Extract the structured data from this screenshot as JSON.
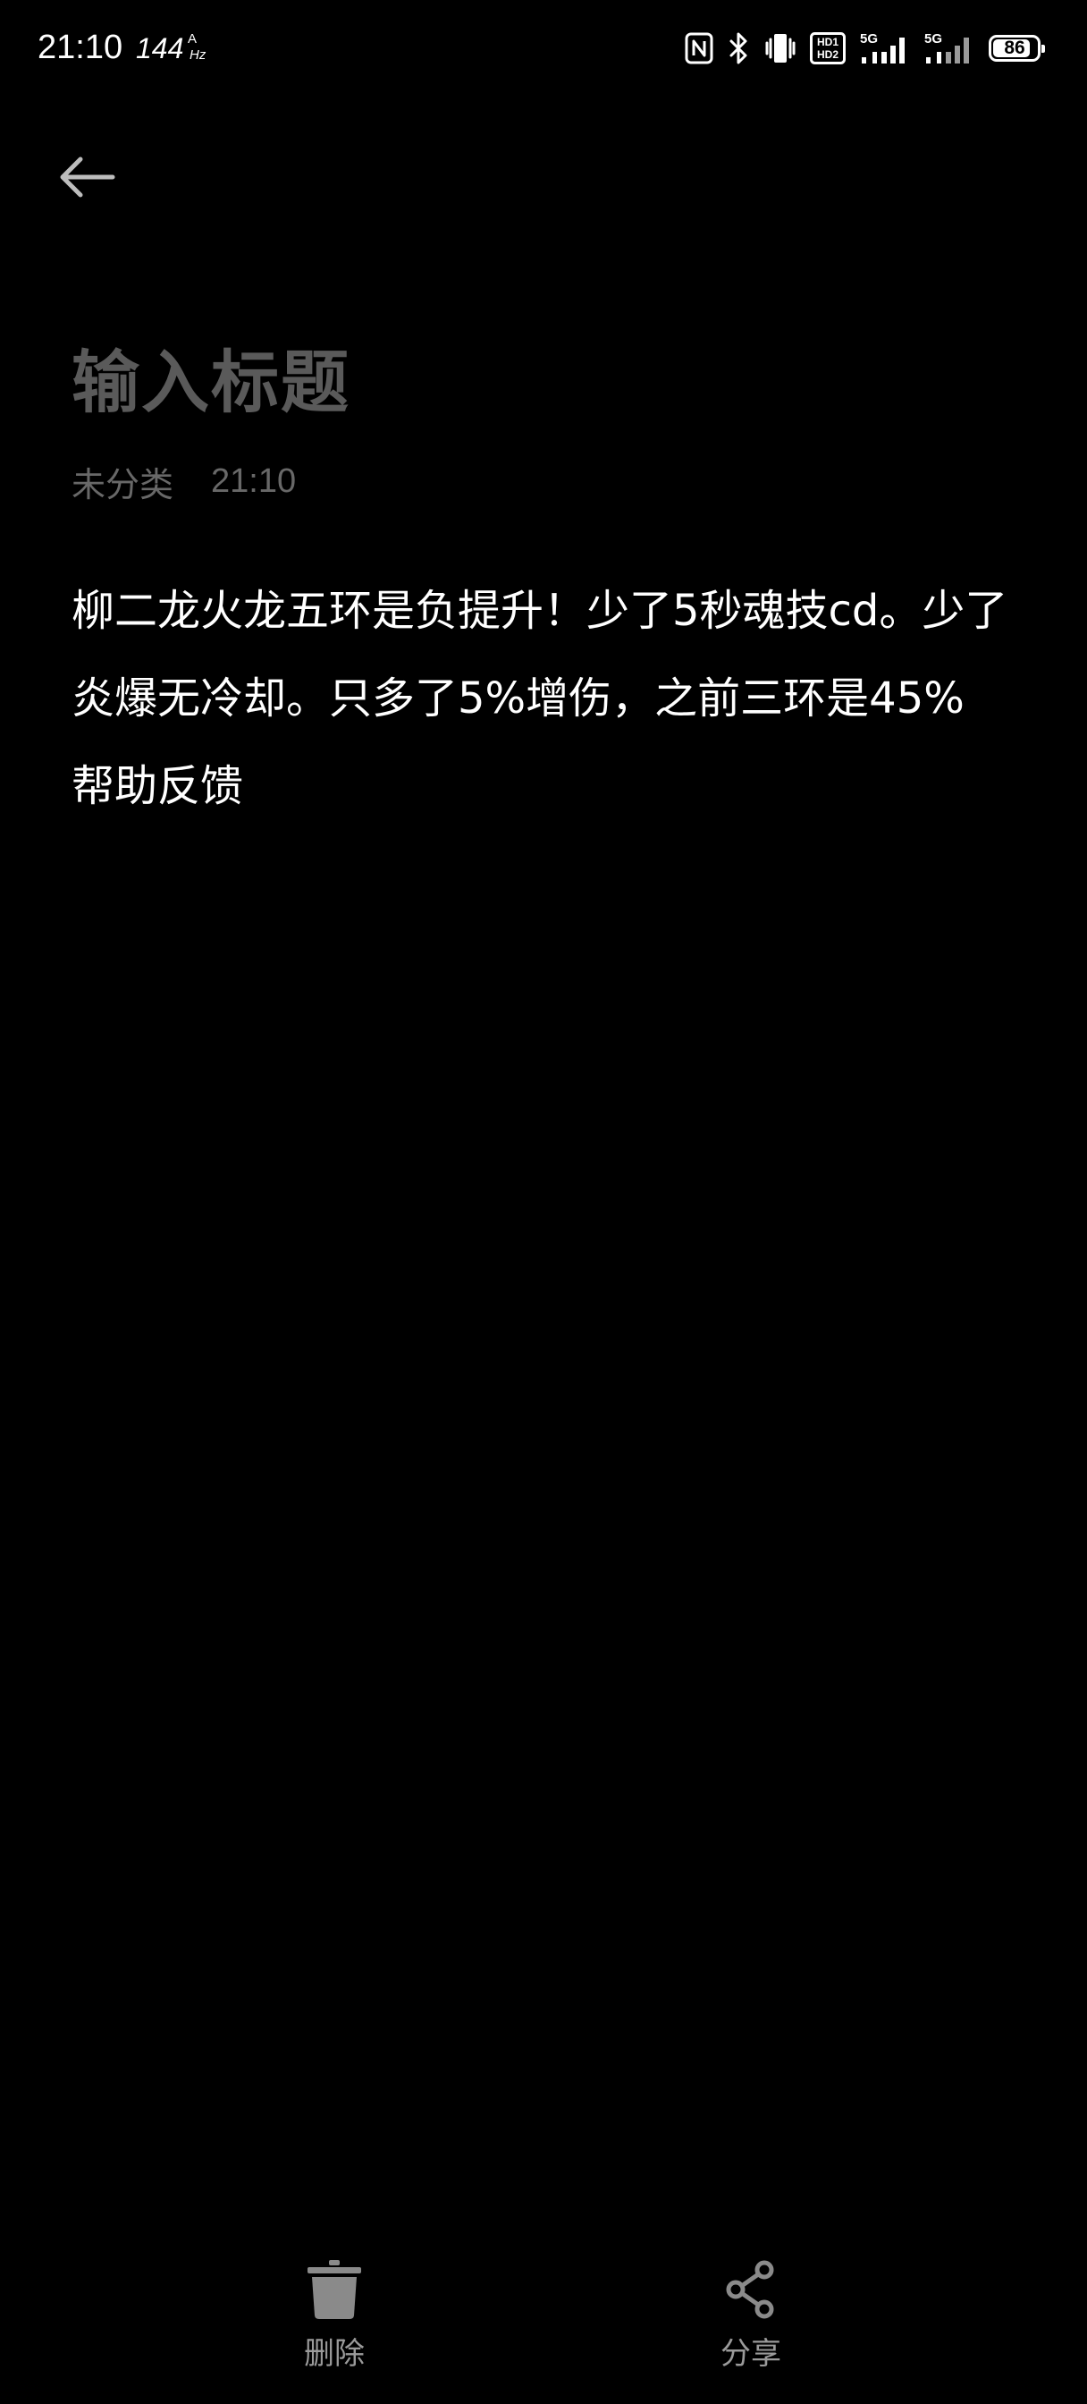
{
  "status_bar": {
    "time": "21:10",
    "refresh_rate": "144",
    "refresh_unit_top": "A",
    "refresh_unit_bottom": "Hz",
    "hd_label_1": "HD1",
    "hd_label_2": "HD2",
    "network_1": "5G",
    "network_2": "5G",
    "battery_level": "86",
    "battery_fraction": 0.86,
    "icons": [
      "nfc-icon",
      "bluetooth-icon",
      "vibrate-icon",
      "hd-voice-icon",
      "signal-5g-icon",
      "signal-5g-icon",
      "battery-icon"
    ]
  },
  "header": {
    "back_icon": "arrow-left-icon"
  },
  "note": {
    "title_placeholder": "输入标题",
    "category": "未分类",
    "time": "21:10",
    "body_lines": [
      "柳二龙火龙五环是负提升！少了5秒魂技cd。少了",
      "炎爆无冷却。只多了5%增伤，之前三环是45%",
      "帮助反馈"
    ]
  },
  "actions": {
    "delete": {
      "label": "删除",
      "icon": "trash-icon"
    },
    "share": {
      "label": "分享",
      "icon": "share-icon"
    }
  },
  "colors": {
    "background": "#000000",
    "title_placeholder": "#5a5a5a",
    "meta_text": "#686868",
    "body_text": "#ffffff",
    "action_icon": "#8a8a8a",
    "action_label": "#9a9a9a"
  }
}
